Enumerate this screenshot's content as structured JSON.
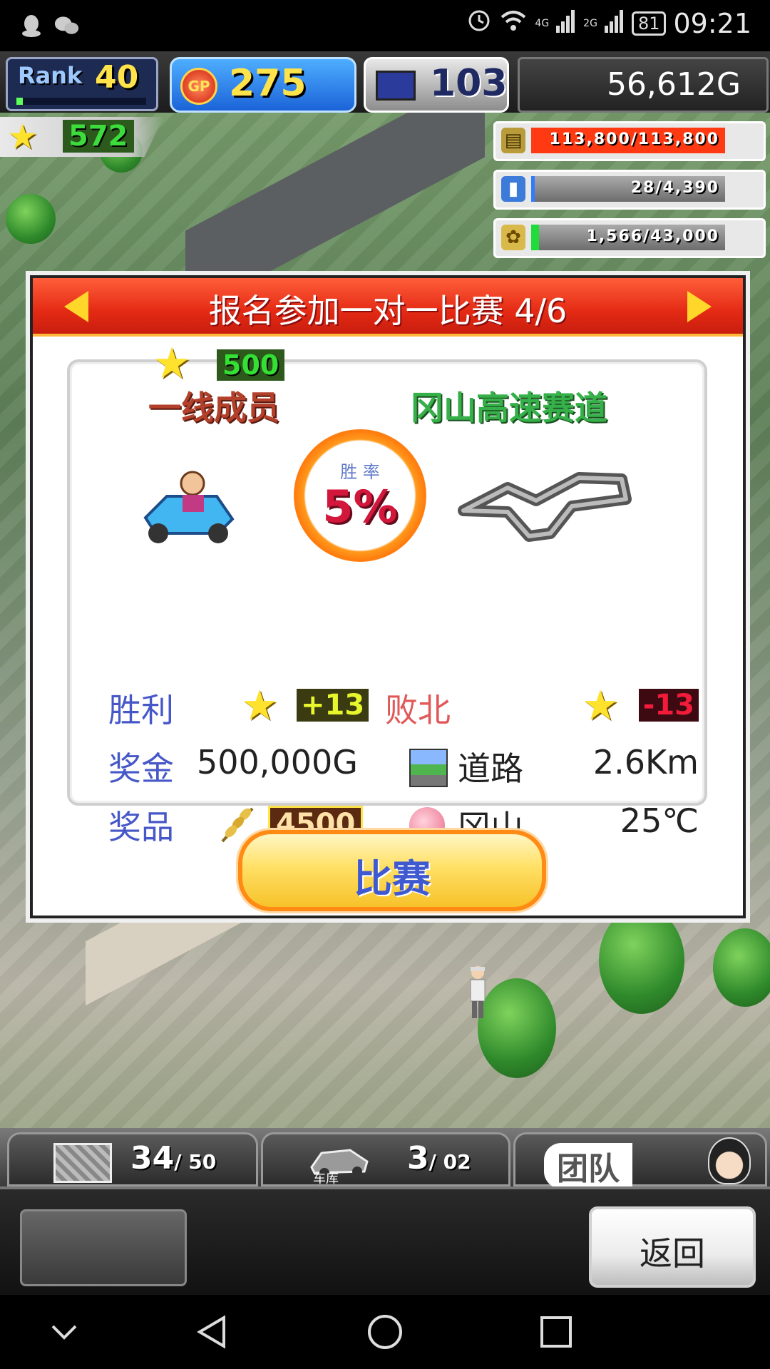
{
  "status_bar": {
    "signal_4g": "4G",
    "signal_2g": "2G",
    "battery": "81",
    "time": "09:21"
  },
  "hud": {
    "rank_label": "Rank",
    "rank_value": "40",
    "rank_progress": 0.05,
    "gp_icon_text": "GP",
    "gp_value": "275",
    "research_value": "103",
    "money": "56,612G",
    "star_value": "572",
    "resources": [
      {
        "icon": "oil-barrel-icon",
        "text": "113,800/113,800",
        "fill": 1.0,
        "color": "#ff3a12"
      },
      {
        "icon": "fuel-bottle-icon",
        "text": "28/4,390",
        "fill": 0.01,
        "color": "#2f7dff"
      },
      {
        "icon": "wheat-icon",
        "text": "1,566/43,000",
        "fill": 0.04,
        "color": "#1fdc3a"
      }
    ]
  },
  "dialog": {
    "title": "报名参加一对一比赛 4/6",
    "required_stars": "500",
    "opponent_rank": "一线成员",
    "track_name": "冈山高速赛道",
    "win_rate_label": "胜 率",
    "win_rate": "5%",
    "win_label": "胜利",
    "win_points": "+13",
    "lose_label": "败北",
    "lose_points": "-13",
    "prize_money_label": "奖金",
    "prize_money": "500,000G",
    "road_label": "道路",
    "distance": "2.6Km",
    "prize_item_label": "奖品",
    "prize_item_amount": "4500",
    "location": "冈山",
    "temperature": "25℃",
    "race_button": "比赛"
  },
  "bottom": {
    "parts_count": "34",
    "parts_max": "/ 50",
    "garage_label": "车库",
    "garage_count": "3",
    "garage_max": "/ 02",
    "team_label": "团队",
    "back_button": "返回"
  }
}
